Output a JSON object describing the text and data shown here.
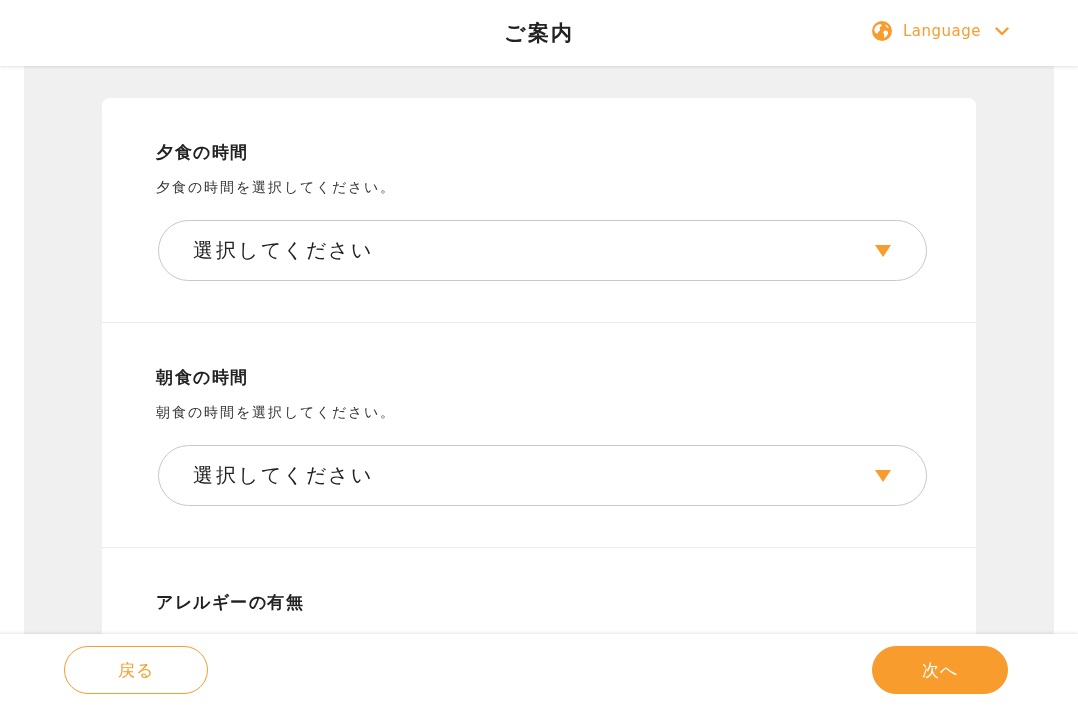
{
  "header": {
    "title": "ご案内",
    "language": {
      "label": "Language"
    }
  },
  "sections": [
    {
      "title": "夕食の時間",
      "description": "夕食の時間を選択してください。",
      "select": {
        "placeholder": "選択してください"
      }
    },
    {
      "title": "朝食の時間",
      "description": "朝食の時間を選択してください。",
      "select": {
        "placeholder": "選択してください"
      }
    },
    {
      "title": "アレルギーの有無"
    }
  ],
  "footer": {
    "buttons": [
      {
        "label": "戻る",
        "kind": "secondary"
      },
      {
        "label": "次へ",
        "kind": "primary"
      }
    ]
  }
}
